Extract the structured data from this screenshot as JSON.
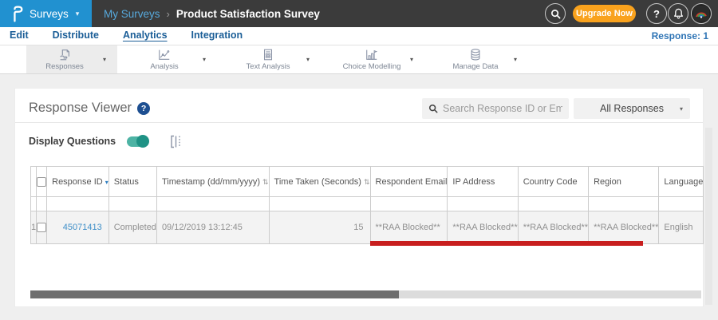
{
  "glyphs": {
    "caret_down": "▾",
    "breadcrumb_sep": "›",
    "sort_desc": "▾",
    "sort_both": "⇅",
    "question": "?"
  },
  "colors": {
    "brand_blue": "#2191d0",
    "topbar_dark": "#3b3b3b",
    "upgrade_orange": "#f9a21d",
    "toggle_teal": "#1f9285",
    "annotation_red": "#c81e1e",
    "response_id_link": "#3f8fc8",
    "tab_blue": "#1b5e97"
  },
  "topbar": {
    "product_menu": "Surveys",
    "breadcrumb_parent": "My Surveys",
    "breadcrumb_current": "Product Satisfaction Survey",
    "upgrade_button": "Upgrade Now",
    "icons": [
      "questionpro-logo",
      "search-icon",
      "help-icon",
      "bell-icon",
      "user-avatar"
    ]
  },
  "nav": {
    "tabs": [
      {
        "label": "Edit",
        "active": false
      },
      {
        "label": "Distribute",
        "active": false
      },
      {
        "label": "Analytics",
        "active": true
      },
      {
        "label": "Integration",
        "active": false
      }
    ],
    "response_count": "Response: 1"
  },
  "toolbar": {
    "items": [
      {
        "label": "Responses",
        "icon": "responses-icon",
        "active": true
      },
      {
        "label": "Analysis",
        "icon": "analysis-icon",
        "active": false
      },
      {
        "label": "Text Analysis",
        "icon": "text-analysis-icon",
        "active": false
      },
      {
        "label": "Choice Modelling",
        "icon": "choice-modelling-icon",
        "active": false
      },
      {
        "label": "Manage Data",
        "icon": "manage-data-icon",
        "active": false
      }
    ]
  },
  "viewer": {
    "title": "Response Viewer",
    "search_placeholder": "Search Response ID or Email",
    "filter_selected": "All Responses",
    "display_questions_label": "Display Questions",
    "display_questions_on": true
  },
  "table": {
    "columns": [
      {
        "label": "",
        "sort": ""
      },
      {
        "label": "",
        "sort": ""
      },
      {
        "label": "Response ID",
        "sort": "desc"
      },
      {
        "label": "Status",
        "sort": ""
      },
      {
        "label": "Timestamp (dd/mm/yyyy)",
        "sort": "both"
      },
      {
        "label": "Time Taken (Seconds)",
        "sort": "both"
      },
      {
        "label": "Respondent Email",
        "sort": ""
      },
      {
        "label": "IP Address",
        "sort": ""
      },
      {
        "label": "Country Code",
        "sort": ""
      },
      {
        "label": "Region",
        "sort": ""
      },
      {
        "label": "Language",
        "sort": ""
      }
    ],
    "row": {
      "index": "1",
      "checked": false,
      "response_id": "45071413",
      "status": "Completed",
      "timestamp": "09/12/2019 13:12:45",
      "time_taken": "15",
      "respondent_email": "**RAA Blocked**",
      "ip_address": "**RAA Blocked**",
      "country_code": "**RAA Blocked**",
      "region": "**RAA Blocked**",
      "language": "English"
    }
  }
}
